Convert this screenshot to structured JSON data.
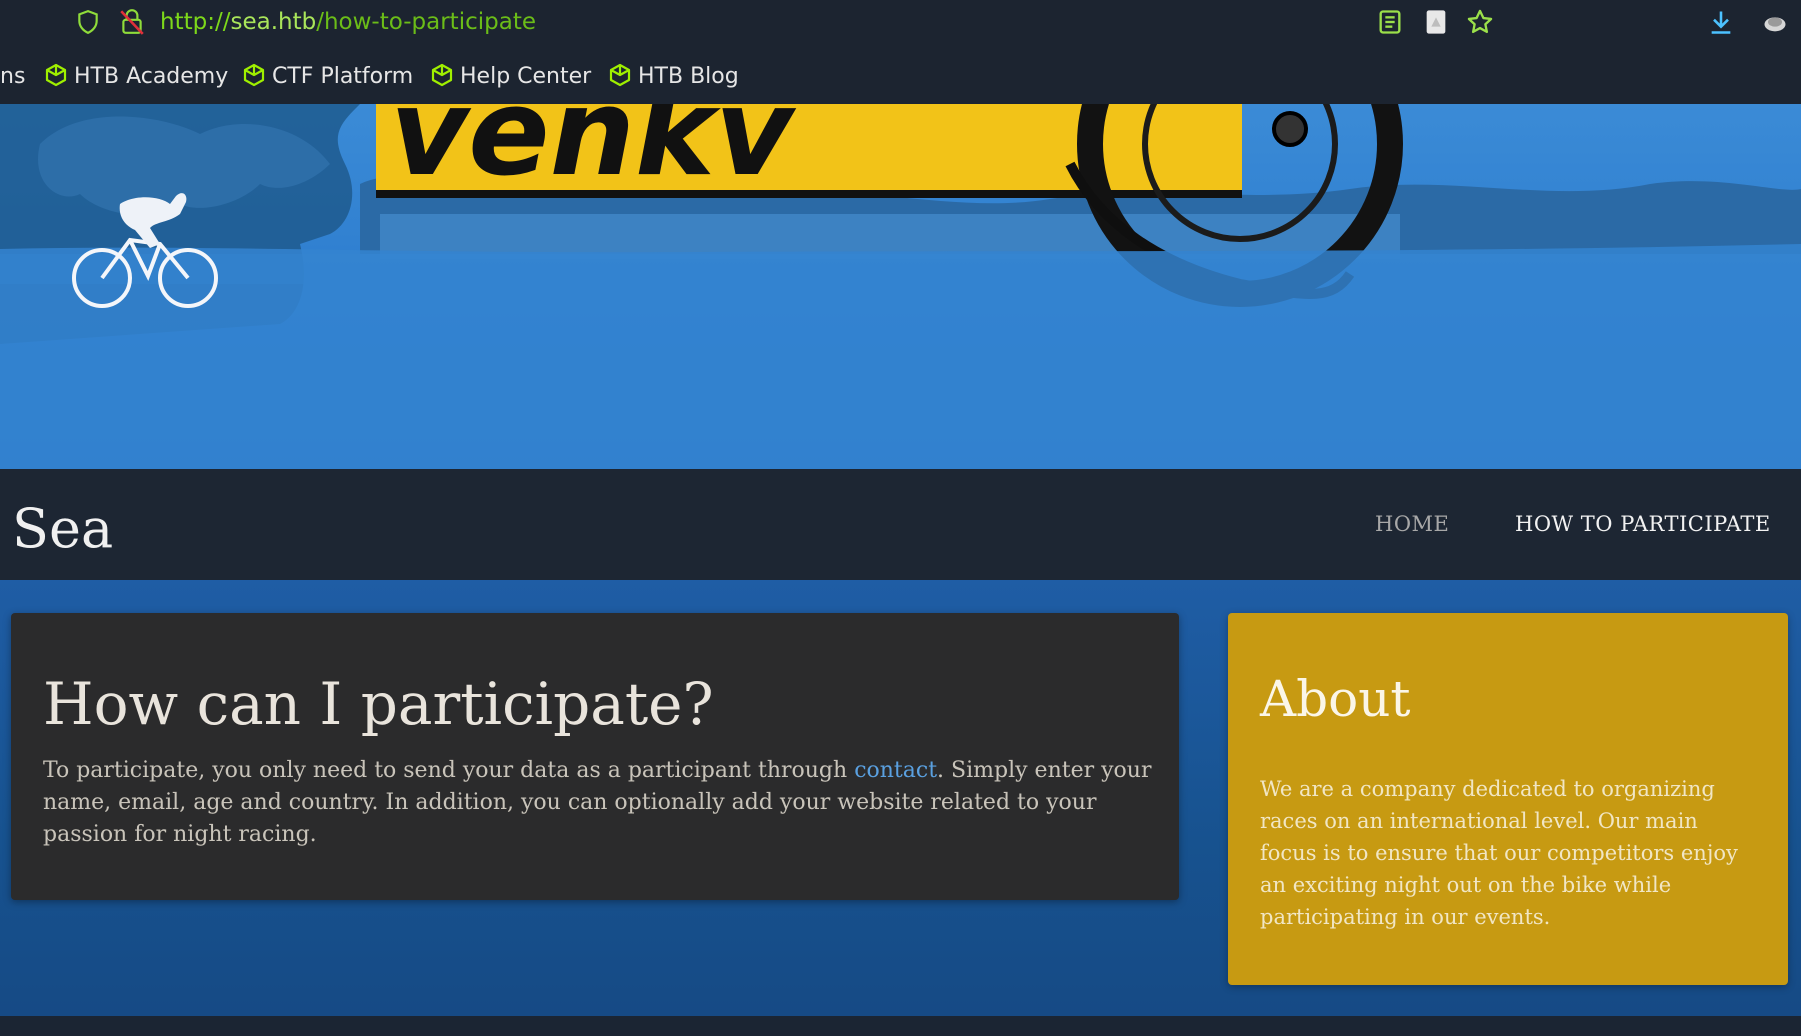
{
  "browser": {
    "url_scheme": "http://",
    "url_host": "sea.htb",
    "url_path": "/how-to-participate",
    "icons": [
      "shield-icon",
      "insecure-lock-icon",
      "reader-view-icon",
      "pdf-icon",
      "bookmark-star-icon",
      "download-icon",
      "extension-icon"
    ],
    "accent_color": "#7dd81a"
  },
  "bookmarks": {
    "partial_label": "ns",
    "items": [
      {
        "label": "HTB Academy"
      },
      {
        "label": "CTF Platform"
      },
      {
        "label": "Help Center"
      },
      {
        "label": "HTB Blog"
      }
    ]
  },
  "hero": {
    "banner_text_fragment": "venkv"
  },
  "site": {
    "title": "Sea",
    "nav": {
      "home": "HOME",
      "how_to_participate": "HOW TO PARTICIPATE"
    }
  },
  "content": {
    "heading": "How can I participate?",
    "text_before_link": "To participate, you only need to send your data as a participant through ",
    "link_text": "contact",
    "text_after_link": ". Simply enter your name, email, age and country. In addition, you can optionally add your website related to your passion for night racing."
  },
  "about": {
    "heading": "About",
    "text": "We are a company dedicated to organizing races on an international level. Our main focus is to ensure that our competitors enjoy an exciting night out on the bike while participating in our events.",
    "color": "#c79a12"
  }
}
